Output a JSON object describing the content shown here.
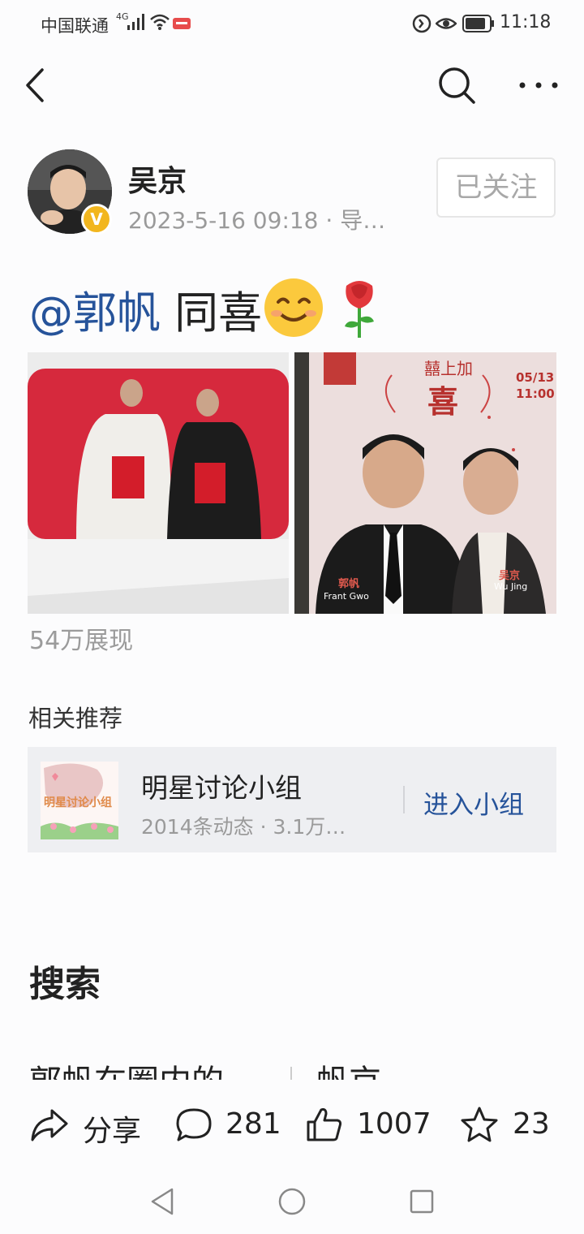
{
  "status_bar": {
    "carrier": "中国联通",
    "network": "4G",
    "time": "11:18"
  },
  "post": {
    "author": "吴京",
    "meta": "2023-5-16 09:18 · 导…",
    "follow_label": "已关注",
    "mention": "@郭帆",
    "text": " 同喜",
    "emojis": [
      "smiling-face-emoji",
      "rose-emoji"
    ],
    "image2_poster": {
      "title": "囍上加",
      "title_big": "喜",
      "date": "05/13",
      "time": "11:00",
      "name_left_cn": "郭帆",
      "name_left_en": "Frant Gwo",
      "name_right_cn": "吴京",
      "name_right_en": "Wu Jing"
    },
    "views": "54万展现"
  },
  "related": {
    "title": "相关推荐",
    "group_name": "明星讨论小组",
    "group_stat": "2014条动态 · 3.1万人…",
    "join_label": "进入小组",
    "thumb_text": "明星讨论小组"
  },
  "search": {
    "title": "搜索",
    "item1": "郭帆在圈内的",
    "item2": "帆京"
  },
  "actions": {
    "share_label": "分享",
    "comments": "281",
    "likes": "1007",
    "favorites": "23"
  },
  "colors": {
    "link_blue": "#26539a",
    "verified_badge": "#f2b61e",
    "card_bg": "#eeeff2"
  }
}
